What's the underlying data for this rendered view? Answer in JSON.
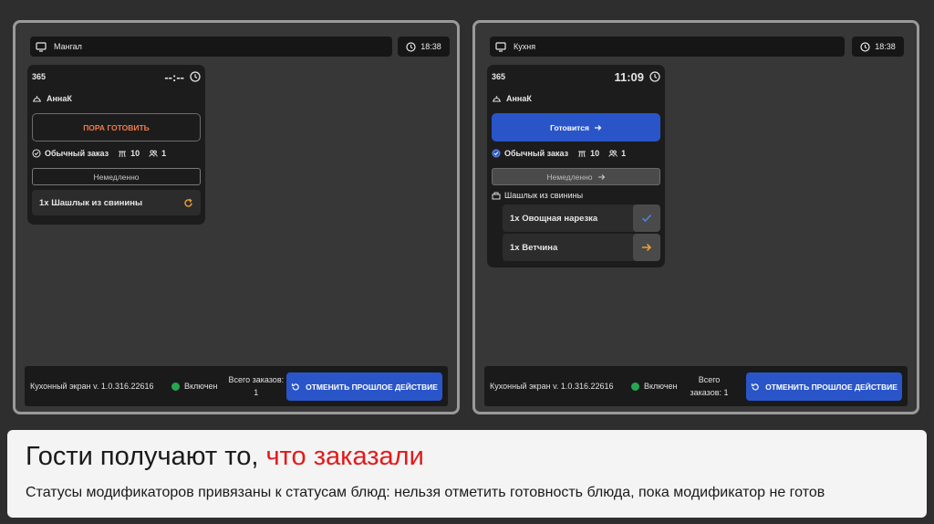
{
  "screens": [
    {
      "station": "Мангал",
      "clock": "18:38",
      "order": {
        "number": "365",
        "timer": "--:--",
        "waiter": "АннаК",
        "action_label": "ПОРА ГОТОВИТЬ",
        "order_type": "Обычный заказ",
        "table": "10",
        "guests": "1",
        "timing": "Немедленно",
        "dish": "1х Шашлык из свинины"
      },
      "footer": {
        "version": "Кухонный экран v. 1.0.316.22616",
        "status": "Включен",
        "total_label": "Всего заказов:",
        "total_value": "1",
        "undo_label": "ОТМЕНИТЬ ПРОШЛОЕ ДЕЙСТВИЕ"
      }
    },
    {
      "station": "Кухня",
      "clock": "18:38",
      "order": {
        "number": "365",
        "timer": "11:09",
        "waiter": "АннаК",
        "action_label": "Готовится",
        "order_type": "Обычный заказ",
        "table": "10",
        "guests": "1",
        "timing": "Немедленно",
        "dish": "Шашлык из свинины",
        "modifiers": [
          {
            "label": "1х Овощная нарезка",
            "state": "check-icon"
          },
          {
            "label": "1х Ветчина",
            "state": "arrow-right-icon"
          }
        ]
      },
      "footer": {
        "version": "Кухонный экран v. 1.0.316.22616",
        "status": "Включен",
        "total_label": "Всего",
        "total_label2": "заказов:",
        "total_value": "1",
        "undo_label": "ОТМЕНИТЬ ПРОШЛОЕ ДЕЙСТВИЕ"
      }
    }
  ],
  "caption": {
    "title_start": "Гости получают то, ",
    "title_highlight": "что заказали",
    "subtitle": "Статусы модификаторов привязаны к статусам блюд: нельзя отметить готовность блюда, пока модификатор не готов"
  },
  "colors": {
    "accent_blue": "#2a55c9",
    "ready_orange": "#f07a4a",
    "status_green": "#26a651",
    "highlight_red": "#e21a1a"
  }
}
